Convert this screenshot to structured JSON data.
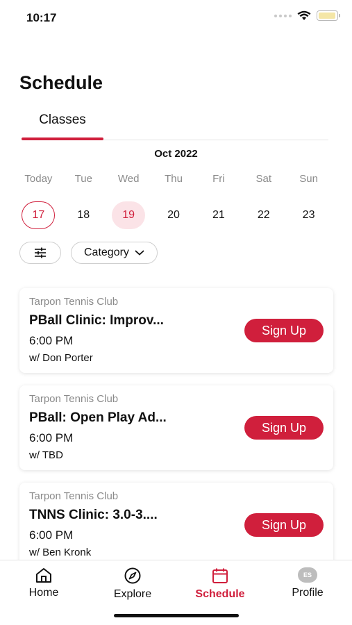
{
  "status_bar": {
    "time": "10:17",
    "battery_level": 0.95
  },
  "page_title": "Schedule",
  "tabs": [
    {
      "label": "Classes",
      "active": true
    }
  ],
  "calendar": {
    "month": "Oct 2022",
    "day_names": [
      "Today",
      "Tue",
      "Wed",
      "Thu",
      "Fri",
      "Sat",
      "Sun"
    ],
    "dates": [
      "17",
      "18",
      "19",
      "20",
      "21",
      "22",
      "23"
    ],
    "today_index": 0,
    "selected_index": 2
  },
  "filters": {
    "category_label": "Category"
  },
  "classes": [
    {
      "venue": "Tarpon Tennis Club",
      "title": "PBall Clinic: Improv...",
      "time": "6:00 PM",
      "instructor": "w/ Don Porter",
      "button": "Sign Up"
    },
    {
      "venue": "Tarpon Tennis Club",
      "title": "PBall: Open Play Ad...",
      "time": "6:00 PM",
      "instructor": "w/ TBD",
      "button": "Sign Up"
    },
    {
      "venue": "Tarpon Tennis Club",
      "title": "TNNS Clinic: 3.0-3....",
      "time": "6:00 PM",
      "instructor": "w/ Ben Kronk",
      "button": "Sign Up"
    }
  ],
  "bottom_nav": [
    {
      "label": "Home",
      "icon": "home-icon",
      "active": false
    },
    {
      "label": "Explore",
      "icon": "compass-icon",
      "active": false
    },
    {
      "label": "Schedule",
      "icon": "calendar-icon",
      "active": true
    },
    {
      "label": "Profile",
      "icon": "avatar",
      "active": false,
      "initials": "ES"
    }
  ],
  "colors": {
    "accent": "#d01f3c",
    "selected_bg": "#fbe3e7",
    "muted_text": "#8a8a8a"
  }
}
